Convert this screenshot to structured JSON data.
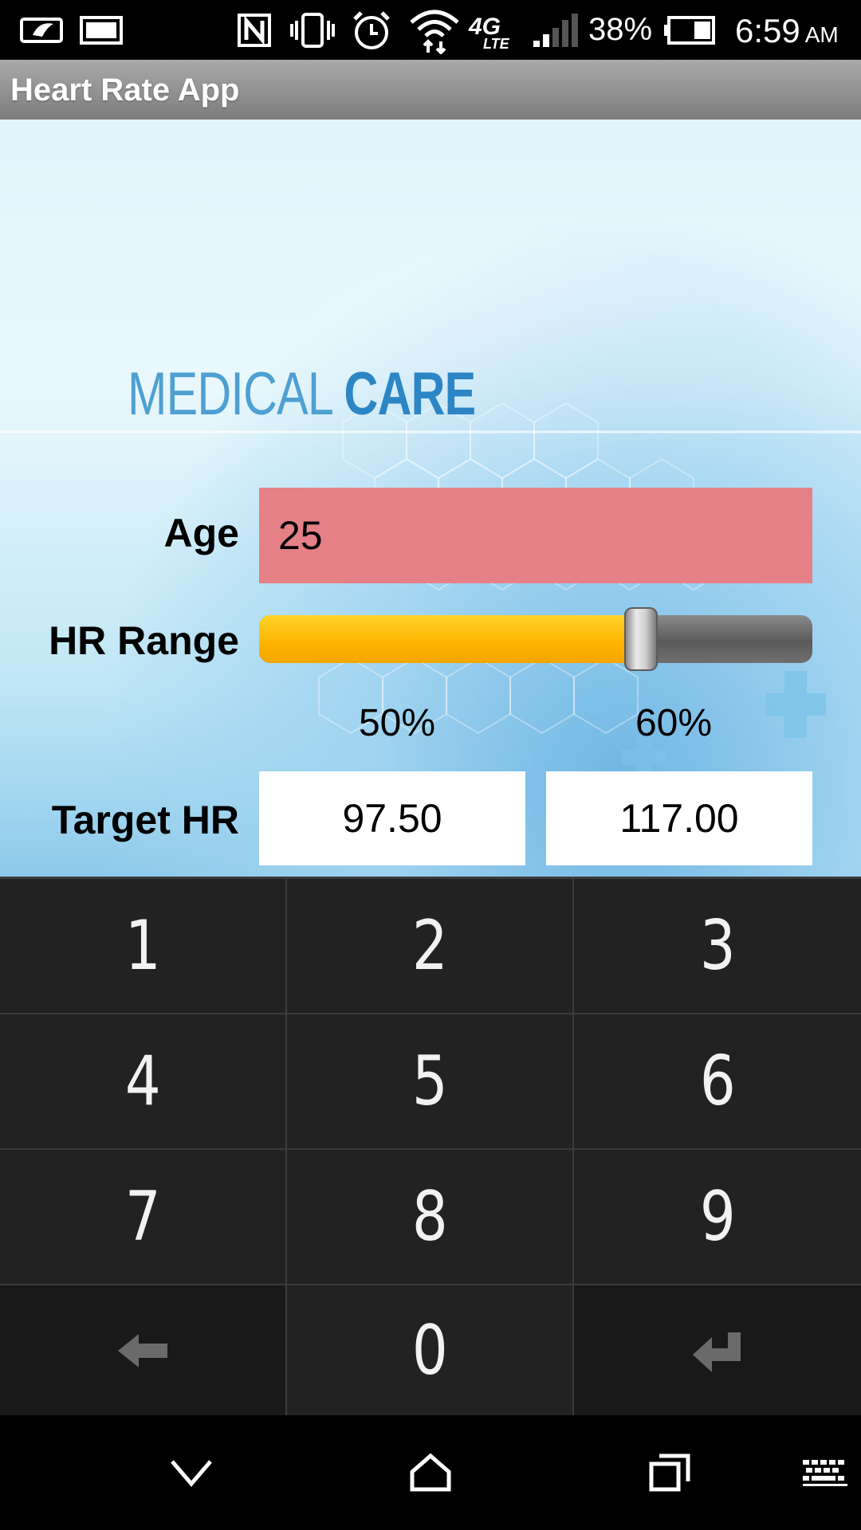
{
  "status_bar": {
    "battery_percent": "38%",
    "time": "6:59",
    "ampm": "AM",
    "network": "4G LTE",
    "icons": [
      "battery-saver-icon",
      "image-icon",
      "nfc-icon",
      "vibrate-icon",
      "alarm-icon",
      "wifi-icon",
      "lte-icon",
      "signal-icon",
      "battery-icon"
    ]
  },
  "app": {
    "title": "Heart Rate App"
  },
  "banner": {
    "word1": "MEDICAL",
    "word2": "CARE"
  },
  "form": {
    "age_label": "Age",
    "age_value": "25",
    "hr_range_label": "HR Range",
    "hr_range_slider_value": 0.69,
    "pct_low": "50%",
    "pct_high": "60%",
    "target_hr_label": "Target HR",
    "target_low": "97.50",
    "target_high": "117.00"
  },
  "keypad": {
    "keys": [
      "1",
      "2",
      "3",
      "4",
      "5",
      "6",
      "7",
      "8",
      "9",
      "0"
    ],
    "backspace_icon": "backspace-arrow-icon",
    "enter_icon": "enter-icon"
  },
  "nav_bar": {
    "icons": [
      "back-chevron-icon",
      "home-icon",
      "recent-apps-icon",
      "keyboard-icon"
    ]
  },
  "colors": {
    "age_field": "#e48086",
    "slider_fill": "#ffb300",
    "keypad_bg": "#222222",
    "title_bar": "#8f8f8f"
  }
}
